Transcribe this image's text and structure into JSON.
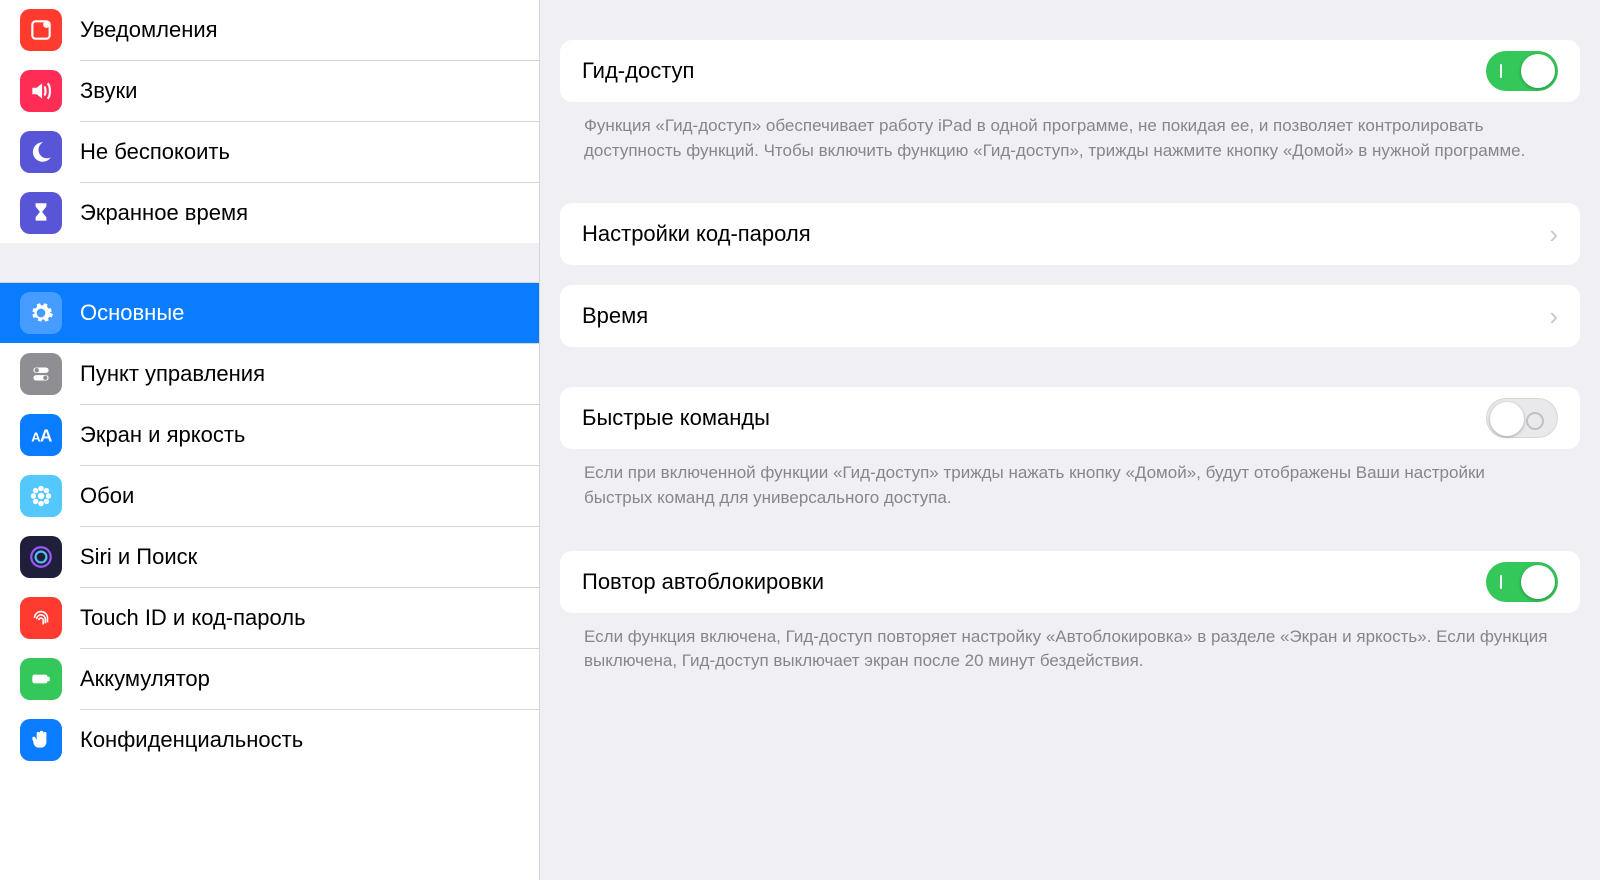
{
  "sidebar": {
    "group1": [
      {
        "icon": "notifications",
        "label": "Уведомления"
      },
      {
        "icon": "sounds",
        "label": "Звуки"
      },
      {
        "icon": "dnd",
        "label": "Не беспокоить"
      },
      {
        "icon": "screentime",
        "label": "Экранное время"
      }
    ],
    "group2": [
      {
        "icon": "general",
        "label": "Основные",
        "selected": true
      },
      {
        "icon": "control",
        "label": "Пункт управления"
      },
      {
        "icon": "display",
        "label": "Экран и яркость"
      },
      {
        "icon": "wallpaper",
        "label": "Обои"
      },
      {
        "icon": "siri",
        "label": "Siri и Поиск"
      },
      {
        "icon": "touchid",
        "label": "Touch ID и код-пароль"
      },
      {
        "icon": "battery",
        "label": "Аккумулятор"
      },
      {
        "icon": "privacy",
        "label": "Конфиденциальность"
      }
    ]
  },
  "content": {
    "guided_access": {
      "label": "Гид-доступ",
      "on": true,
      "footnote": "Функция «Гид-доступ» обеспечивает работу iPad в одной программе, не покидая ее, и позволяет контролировать доступность функций. Чтобы включить функцию «Гид-доступ», трижды нажмите кнопку «Домой» в нужной программе."
    },
    "passcode": {
      "label": "Настройки код-пароля"
    },
    "time": {
      "label": "Время"
    },
    "shortcuts": {
      "label": "Быстрые команды",
      "on": false,
      "footnote": "Если при включенной функции «Гид-доступ» трижды нажать кнопку «Домой», будут отображены Ваши настройки быстрых команд для универсального доступа."
    },
    "mirror_autolock": {
      "label": "Повтор автоблокировки",
      "on": true,
      "footnote": "Если функция включена, Гид-доступ повторяет настройку «Автоблокировка» в разделе «Экран и яркость». Если функция выключена, Гид-доступ выключает экран после 20 минут бездействия."
    }
  }
}
